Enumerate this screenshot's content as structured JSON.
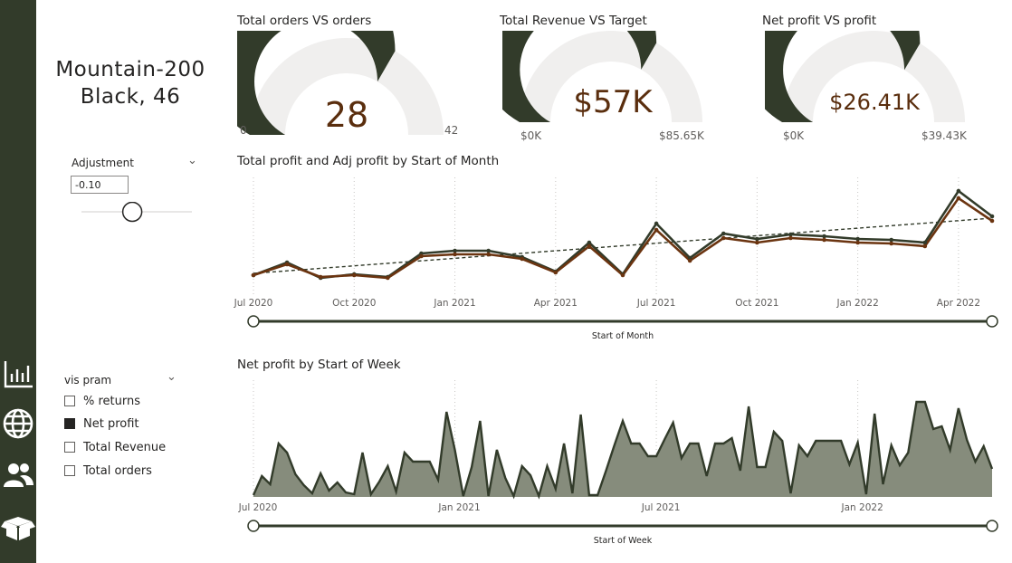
{
  "product": {
    "line1": "Mountain-200",
    "line2": "Black, 46"
  },
  "nav": {
    "icons": [
      "bar-chart-icon",
      "globe-icon",
      "users-icon",
      "box-icon"
    ]
  },
  "adjustment": {
    "title": "Adjustment",
    "value": "-0.10",
    "slider_fraction": 0.46
  },
  "vis_param": {
    "title": "vis pram",
    "options": [
      {
        "label": "% returns",
        "checked": false
      },
      {
        "label": "Net profit",
        "checked": true
      },
      {
        "label": "Total Revenue",
        "checked": false
      },
      {
        "label": "Total orders",
        "checked": false
      }
    ]
  },
  "gauges": [
    {
      "title": "Total orders VS orders",
      "value_label": "28",
      "value": 28,
      "min": 0,
      "max": 42,
      "min_label": "0",
      "max_label": "42"
    },
    {
      "title": "Total Revenue VS Target",
      "value_label": "$57K",
      "value": 57000,
      "min": 0,
      "max": 85650,
      "min_label": "$0K",
      "max_label": "$85.65K"
    },
    {
      "title": "Net profit VS profit",
      "value_label": "$26.41K",
      "value": 26410,
      "min": 0,
      "max": 39430,
      "min_label": "$0K",
      "max_label": "$39.43K"
    }
  ],
  "colors": {
    "sidebar": "#323b2a",
    "gauge_fill": "#323b2a",
    "gauge_track": "#f0efee",
    "gauge_value": "#5a2e0e",
    "profit_line": "#323b2a",
    "adj_line": "#6b3410",
    "trend": "#323b2a",
    "area_fill": "#868c7c",
    "area_line": "#323b2a"
  },
  "chart_data": [
    {
      "type": "line",
      "title": "Total profit and Adj profit by Start of Month",
      "x_ticks": [
        "Jul 2020",
        "Oct 2020",
        "Jan 2021",
        "Apr 2021",
        "Jul 2021",
        "Oct 2021",
        "Jan 2022",
        "Apr 2022"
      ],
      "x": [
        "2020-07",
        "2020-08",
        "2020-09",
        "2020-10",
        "2020-11",
        "2020-12",
        "2021-01",
        "2021-02",
        "2021-03",
        "2021-04",
        "2021-05",
        "2021-06",
        "2021-07",
        "2021-08",
        "2021-09",
        "2021-10",
        "2021-11",
        "2021-12",
        "2022-01",
        "2022-02",
        "2022-03",
        "2022-04",
        "2022-05",
        "2022-06"
      ],
      "series": [
        {
          "values": [
            0,
            14,
            -3,
            1,
            -2,
            24,
            27,
            27,
            20,
            4,
            36,
            1,
            57,
            19,
            46,
            40,
            45,
            43,
            40,
            39,
            36,
            93,
            65
          ]
        },
        {
          "values": [
            0,
            12,
            -2,
            0,
            -3,
            21,
            23,
            23,
            18,
            3,
            32,
            0,
            50,
            16,
            41,
            36,
            41,
            39,
            36,
            35,
            32,
            85,
            60
          ]
        }
      ],
      "trend": {
        "start": 2,
        "end": 63
      },
      "slider_labels": {
        "axis": "Start of Month"
      }
    },
    {
      "type": "area",
      "title": "Net profit by Start of Week",
      "x_ticks": [
        "Jul 2020",
        "Jan 2021",
        "Jul 2021",
        "Jan 2022"
      ],
      "series": [
        {
          "values": [
            2,
            23,
            14,
            59,
            49,
            25,
            13,
            4,
            26,
            7,
            16,
            5,
            3,
            49,
            3,
            17,
            34,
            6,
            49,
            39,
            39,
            39,
            19,
            94,
            52,
            1,
            33,
            84,
            1,
            52,
            21,
            1,
            34,
            24,
            1,
            34,
            9,
            59,
            4,
            91,
            2,
            2,
            29,
            57,
            84,
            59,
            59,
            45,
            45,
            64,
            82,
            43,
            59,
            59,
            23,
            59,
            59,
            65,
            29,
            100,
            33,
            33,
            72,
            62,
            4,
            57,
            45,
            62,
            62,
            62,
            62,
            36,
            60,
            3,
            92,
            14,
            57,
            35,
            49,
            105,
            105,
            75,
            78,
            52,
            98,
            63,
            39,
            56,
            31
          ]
        }
      ],
      "slider_labels": {
        "axis": "Start of Week"
      }
    }
  ]
}
